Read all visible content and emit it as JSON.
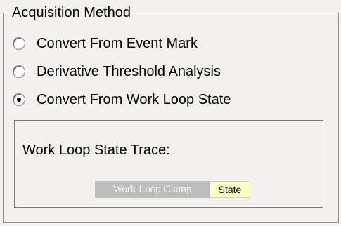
{
  "acquisition": {
    "title": "Acquisition Method",
    "options": [
      {
        "label": "Convert From Event Mark",
        "selected": false
      },
      {
        "label": "Derivative Threshold Analysis",
        "selected": false
      },
      {
        "label": "Convert From Work Loop State",
        "selected": true
      }
    ],
    "selected_option": "Convert From Work Loop State"
  },
  "trace": {
    "title": "Work Loop State Trace:",
    "segments": [
      {
        "label": "Work Loop Clamp",
        "color": "#bdbdbd",
        "text_color": "#f7f7f7"
      },
      {
        "label": "State",
        "color": "#fefdc4",
        "text_color": "#000000"
      }
    ]
  }
}
